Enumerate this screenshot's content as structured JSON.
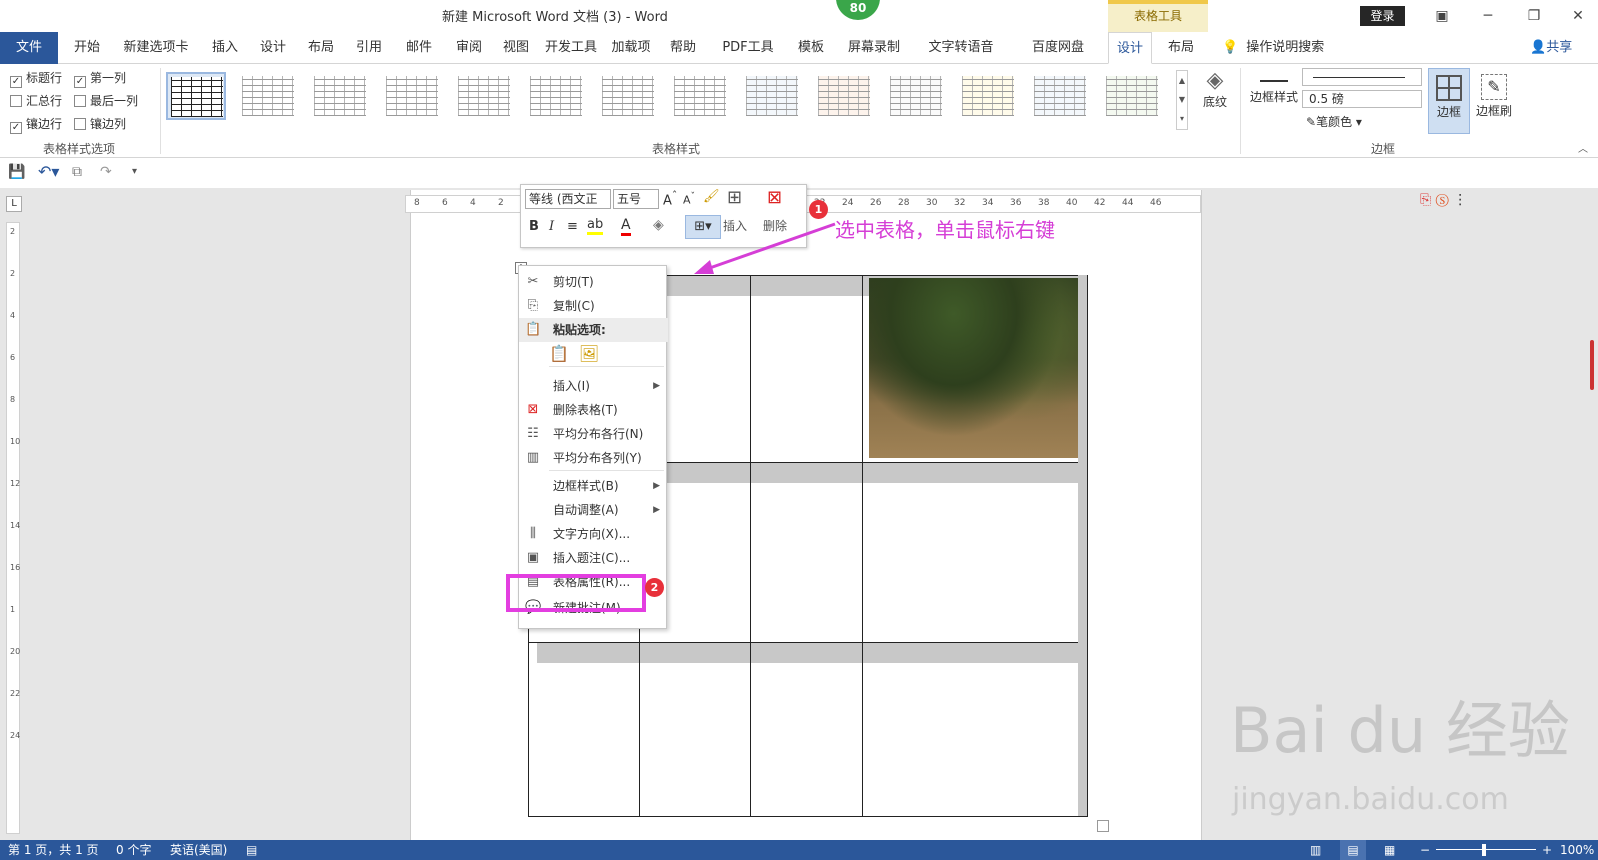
{
  "window": {
    "title": "新建 Microsoft Word 文档 (3) - Word",
    "context_tab_group": "表格工具",
    "login_label": "登录",
    "notification_count": "80"
  },
  "tabs": {
    "file": "文件",
    "items": [
      "开始",
      "新建选项卡",
      "插入",
      "设计",
      "布局",
      "引用",
      "邮件",
      "审阅",
      "视图",
      "开发工具",
      "加载项",
      "帮助",
      "PDF工具",
      "模板",
      "屏幕录制",
      "文字转语音",
      "百度网盘",
      "设计",
      "布局"
    ],
    "active_index": 17,
    "tell_me": "操作说明搜索",
    "share": "共享"
  },
  "ribbon": {
    "style_options": {
      "checkboxes": [
        {
          "label": "标题行",
          "checked": true
        },
        {
          "label": "第一列",
          "checked": true
        },
        {
          "label": "汇总行",
          "checked": false
        },
        {
          "label": "最后一列",
          "checked": false
        },
        {
          "label": "镶边行",
          "checked": true
        },
        {
          "label": "镶边列",
          "checked": false
        }
      ],
      "group_label": "表格样式选项"
    },
    "table_styles": {
      "group_label": "表格样式",
      "shading_label": "底纹"
    },
    "borders": {
      "border_styles_label": "边框样式",
      "weight": "0.5 磅",
      "pen_color_label": "笔颜色",
      "borders_label": "边框",
      "border_painter_label": "边框刷",
      "group_label": "边框"
    }
  },
  "mini_toolbar": {
    "font_name": "等线 (西文正",
    "font_size": "五号",
    "bold": "B",
    "italic": "I",
    "insert_label": "插入",
    "delete_label": "删除"
  },
  "ruler": {
    "h_ticks_left": [
      "8",
      "6",
      "4",
      "2"
    ],
    "h_ticks_right": [
      "22",
      "24",
      "26",
      "28",
      "30",
      "32",
      "34",
      "36",
      "38",
      "40",
      "42",
      "44",
      "46"
    ],
    "v_ticks": [
      "2",
      "2",
      "4",
      "6",
      "8",
      "10",
      "12",
      "14",
      "16",
      "1",
      "20",
      "22",
      "24"
    ]
  },
  "context_menu": {
    "items": [
      {
        "label": "剪切(T)",
        "icon": "scissors-icon",
        "sub": false
      },
      {
        "label": "复制(C)",
        "icon": "copy-icon",
        "sub": false
      },
      {
        "label": "粘贴选项:",
        "icon": "paste-icon",
        "sub": false
      },
      {
        "label": "插入(I)",
        "icon": "",
        "sub": true
      },
      {
        "label": "删除表格(T)",
        "icon": "delete-table-icon",
        "sub": false
      },
      {
        "label": "平均分布各行(N)",
        "icon": "distribute-rows-icon",
        "sub": false
      },
      {
        "label": "平均分布各列(Y)",
        "icon": "distribute-columns-icon",
        "sub": false
      },
      {
        "label": "边框样式(B)",
        "icon": "",
        "sub": true
      },
      {
        "label": "自动调整(A)",
        "icon": "",
        "sub": true
      },
      {
        "label": "文字方向(X)...",
        "icon": "text-direction-icon",
        "sub": false
      },
      {
        "label": "插入题注(C)...",
        "icon": "caption-icon",
        "sub": false
      },
      {
        "label": "表格属性(R)...",
        "icon": "table-properties-icon",
        "sub": false
      },
      {
        "label": "新建批注(M)",
        "icon": "comment-icon",
        "sub": false
      }
    ]
  },
  "annotation": {
    "text": "选中表格，单击鼠标右键",
    "step1": "1",
    "step2": "2",
    "color": "#d53ed6"
  },
  "status_bar": {
    "page": "第 1 页，共 1 页",
    "words": "0 个字",
    "language": "英语(美国)",
    "zoom": "100%"
  },
  "watermark": {
    "text": "Bai du 经验",
    "url": "jingyan.baidu.com"
  },
  "colors": {
    "accent": "#2b579a",
    "highlight": "#e33ee0",
    "badge": "#e8303a"
  }
}
